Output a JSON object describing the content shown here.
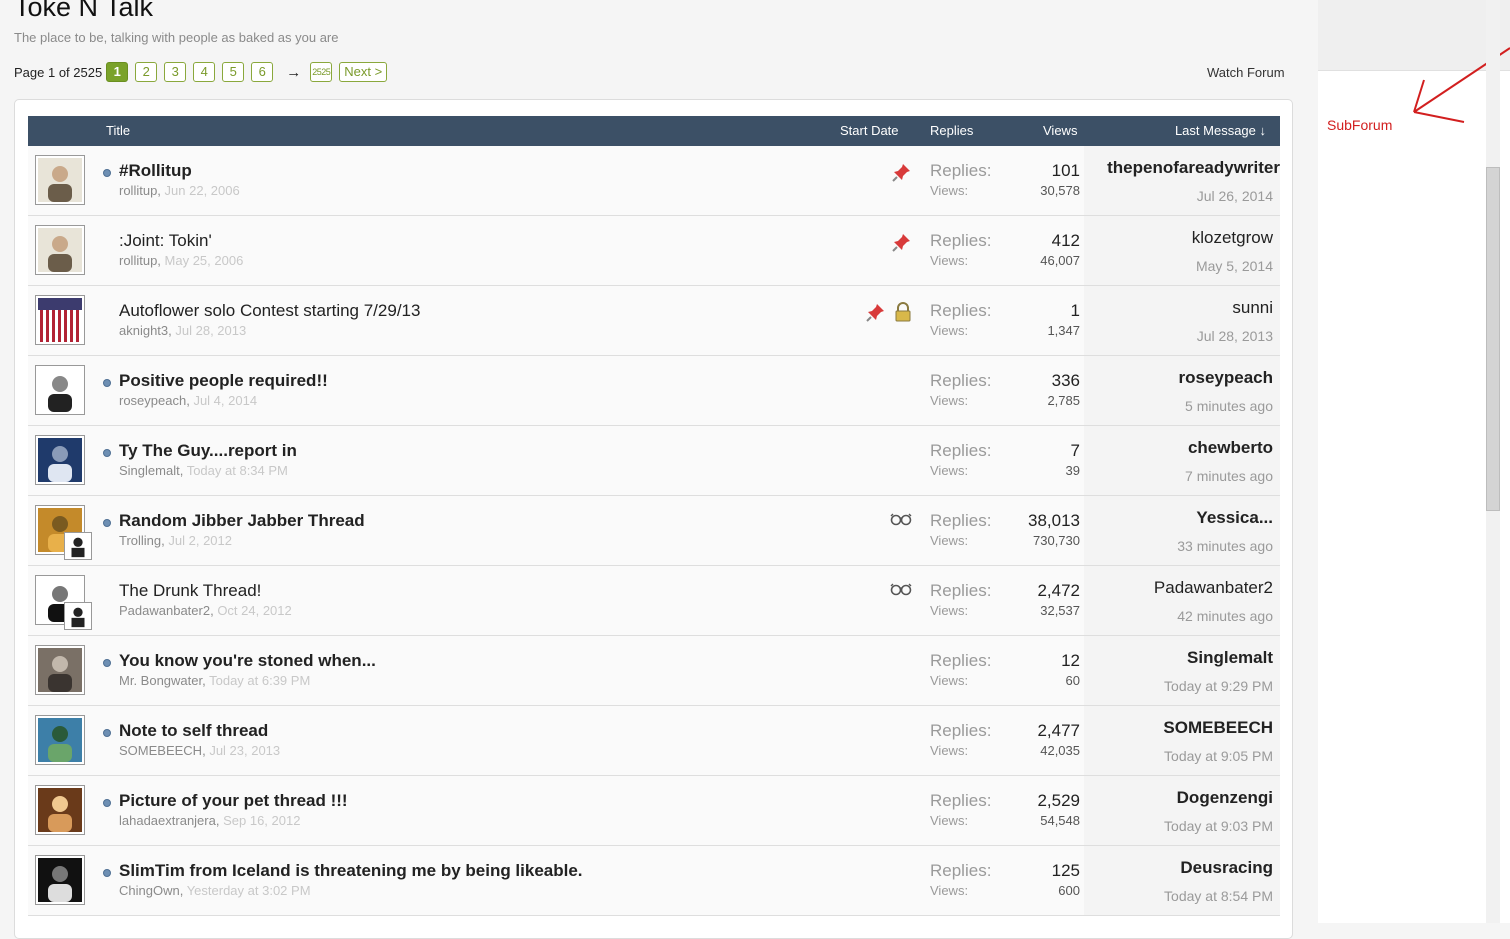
{
  "forum": {
    "title": "Toke N Talk",
    "description": "The place to be, talking with people as baked as you are",
    "watch_label": "Watch Forum"
  },
  "pagination": {
    "label": "Page 1 of 2525",
    "pages": [
      "1",
      "2",
      "3",
      "4",
      "5",
      "6"
    ],
    "arrow": "→",
    "last_page": "2525",
    "next_label": "Next >"
  },
  "table": {
    "headers": {
      "title": "Title",
      "start_date": "Start Date",
      "replies": "Replies",
      "views": "Views",
      "last_message": "Last Message ↓"
    },
    "replies_label": "Replies:",
    "views_label": "Views:"
  },
  "threads": [
    {
      "title": "#Rollitup",
      "author": "rollitup",
      "date": "Jun 22, 2006",
      "replies": "101",
      "views": "30,578",
      "last_user": "thepenofareadywriter",
      "last_time": "Jul 26, 2014",
      "unread": true,
      "icons": [
        "pin-icon"
      ]
    },
    {
      "title": ":Joint: Tokin'",
      "author": "rollitup",
      "date": "May 25, 2006",
      "replies": "412",
      "views": "46,007",
      "last_user": "klozetgrow",
      "last_time": "May 5, 2014",
      "unread": false,
      "icons": [
        "pin-icon"
      ]
    },
    {
      "title": "Autoflower solo Contest starting 7/29/13",
      "author": "aknight3",
      "date": "Jul 28, 2013",
      "replies": "1",
      "views": "1,347",
      "last_user": "sunni",
      "last_time": "Jul 28, 2013",
      "unread": false,
      "icons": [
        "pin-icon",
        "lock-icon"
      ]
    },
    {
      "title": "Positive people required!!",
      "author": "roseypeach",
      "date": "Jul 4, 2014",
      "replies": "336",
      "views": "2,785",
      "last_user": "roseypeach",
      "last_time": "5 minutes ago",
      "unread": true,
      "icons": []
    },
    {
      "title": "Ty The Guy....report in",
      "author": "Singlemalt",
      "date": "Today at 8:34 PM",
      "replies": "7",
      "views": "39",
      "last_user": "chewberto",
      "last_time": "7 minutes ago",
      "unread": true,
      "icons": []
    },
    {
      "title": "Random Jibber Jabber Thread",
      "author": "Trolling",
      "date": "Jul 2, 2012",
      "replies": "38,013",
      "views": "730,730",
      "last_user": "Yessica...",
      "last_time": "33 minutes ago",
      "unread": true,
      "icons": [
        "glasses-icon"
      ]
    },
    {
      "title": "The Drunk Thread!",
      "author": "Padawanbater2",
      "date": "Oct 24, 2012",
      "replies": "2,472",
      "views": "32,537",
      "last_user": "Padawanbater2",
      "last_time": "42 minutes ago",
      "unread": false,
      "icons": [
        "glasses-icon"
      ]
    },
    {
      "title": "You know you're stoned when...",
      "author": "Mr. Bongwater",
      "date": "Today at 6:39 PM",
      "replies": "12",
      "views": "60",
      "last_user": "Singlemalt",
      "last_time": "Today at 9:29 PM",
      "unread": true,
      "icons": []
    },
    {
      "title": "Note to self thread",
      "author": "SOMEBEECH",
      "date": "Jul 23, 2013",
      "replies": "2,477",
      "views": "42,035",
      "last_user": "SOMEBEECH",
      "last_time": "Today at 9:05 PM",
      "unread": true,
      "icons": []
    },
    {
      "title": "Picture of your pet thread !!!",
      "author": "lahadaextranjera",
      "date": "Sep 16, 2012",
      "replies": "2,529",
      "views": "54,548",
      "last_user": "Dogenzengi",
      "last_time": "Today at 9:03 PM",
      "unread": true,
      "icons": []
    },
    {
      "title": "SlimTim from Iceland is threatening me by being likeable.",
      "author": "ChingOwn",
      "date": "Yesterday at 3:02 PM",
      "replies": "125",
      "views": "600",
      "last_user": "Deusracing",
      "last_time": "Today at 8:54 PM",
      "unread": true,
      "icons": []
    }
  ],
  "sidebar": {
    "annotation_label": "SubForum"
  },
  "colors": {
    "header_bg": "#3c5066",
    "page_current": "#7aa22a",
    "annotation_red": "#d21f1f"
  }
}
